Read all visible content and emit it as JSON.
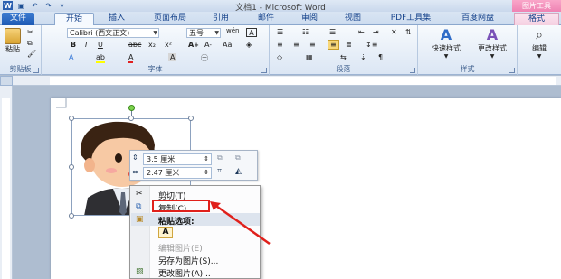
{
  "window": {
    "title": "文档1 - Microsoft Word",
    "context_tab_group": "图片工具"
  },
  "tabs": [
    {
      "label": "文件"
    },
    {
      "label": "开始"
    },
    {
      "label": "插入"
    },
    {
      "label": "页面布局"
    },
    {
      "label": "引用"
    },
    {
      "label": "邮件"
    },
    {
      "label": "审阅"
    },
    {
      "label": "视图"
    },
    {
      "label": "PDF工具集"
    },
    {
      "label": "百度网盘"
    },
    {
      "label": "格式"
    }
  ],
  "ribbon": {
    "clipboard": {
      "label": "剪贴板",
      "paste": "粘贴"
    },
    "font": {
      "label": "字体",
      "font_name": "Calibri (西文正文)",
      "font_size": "五号",
      "wen": "wén",
      "big_a": "A"
    },
    "paragraph": {
      "label": "段落"
    },
    "styles": {
      "label": "样式",
      "quick_styles": "快速样式",
      "change_styles": "更改样式"
    },
    "editing": {
      "label": "编辑"
    }
  },
  "mini_toolbar": {
    "height": "3.5 厘米",
    "width": "2.47 厘米"
  },
  "context_menu": {
    "items": [
      {
        "label": "剪切(T)",
        "icon": "scissors-icon",
        "state": "normal"
      },
      {
        "label": "复制(C)",
        "icon": "copy-icon",
        "state": "highlighted"
      },
      {
        "label": "粘贴选项:",
        "icon": "paste-icon",
        "state": "header"
      },
      {
        "label": "A",
        "icon": "paste-text-icon",
        "state": "option"
      },
      {
        "label": "编辑图片(E)",
        "icon": "",
        "state": "disabled"
      },
      {
        "label": "另存为图片(S)...",
        "icon": "",
        "state": "normal"
      },
      {
        "label": "更改图片(A)...",
        "icon": "change-picture-icon",
        "state": "normal"
      }
    ]
  },
  "colors": {
    "file_tab": "#2a67c1",
    "context_tab": "#e45f9d",
    "highlight_box": "#e0201b"
  }
}
